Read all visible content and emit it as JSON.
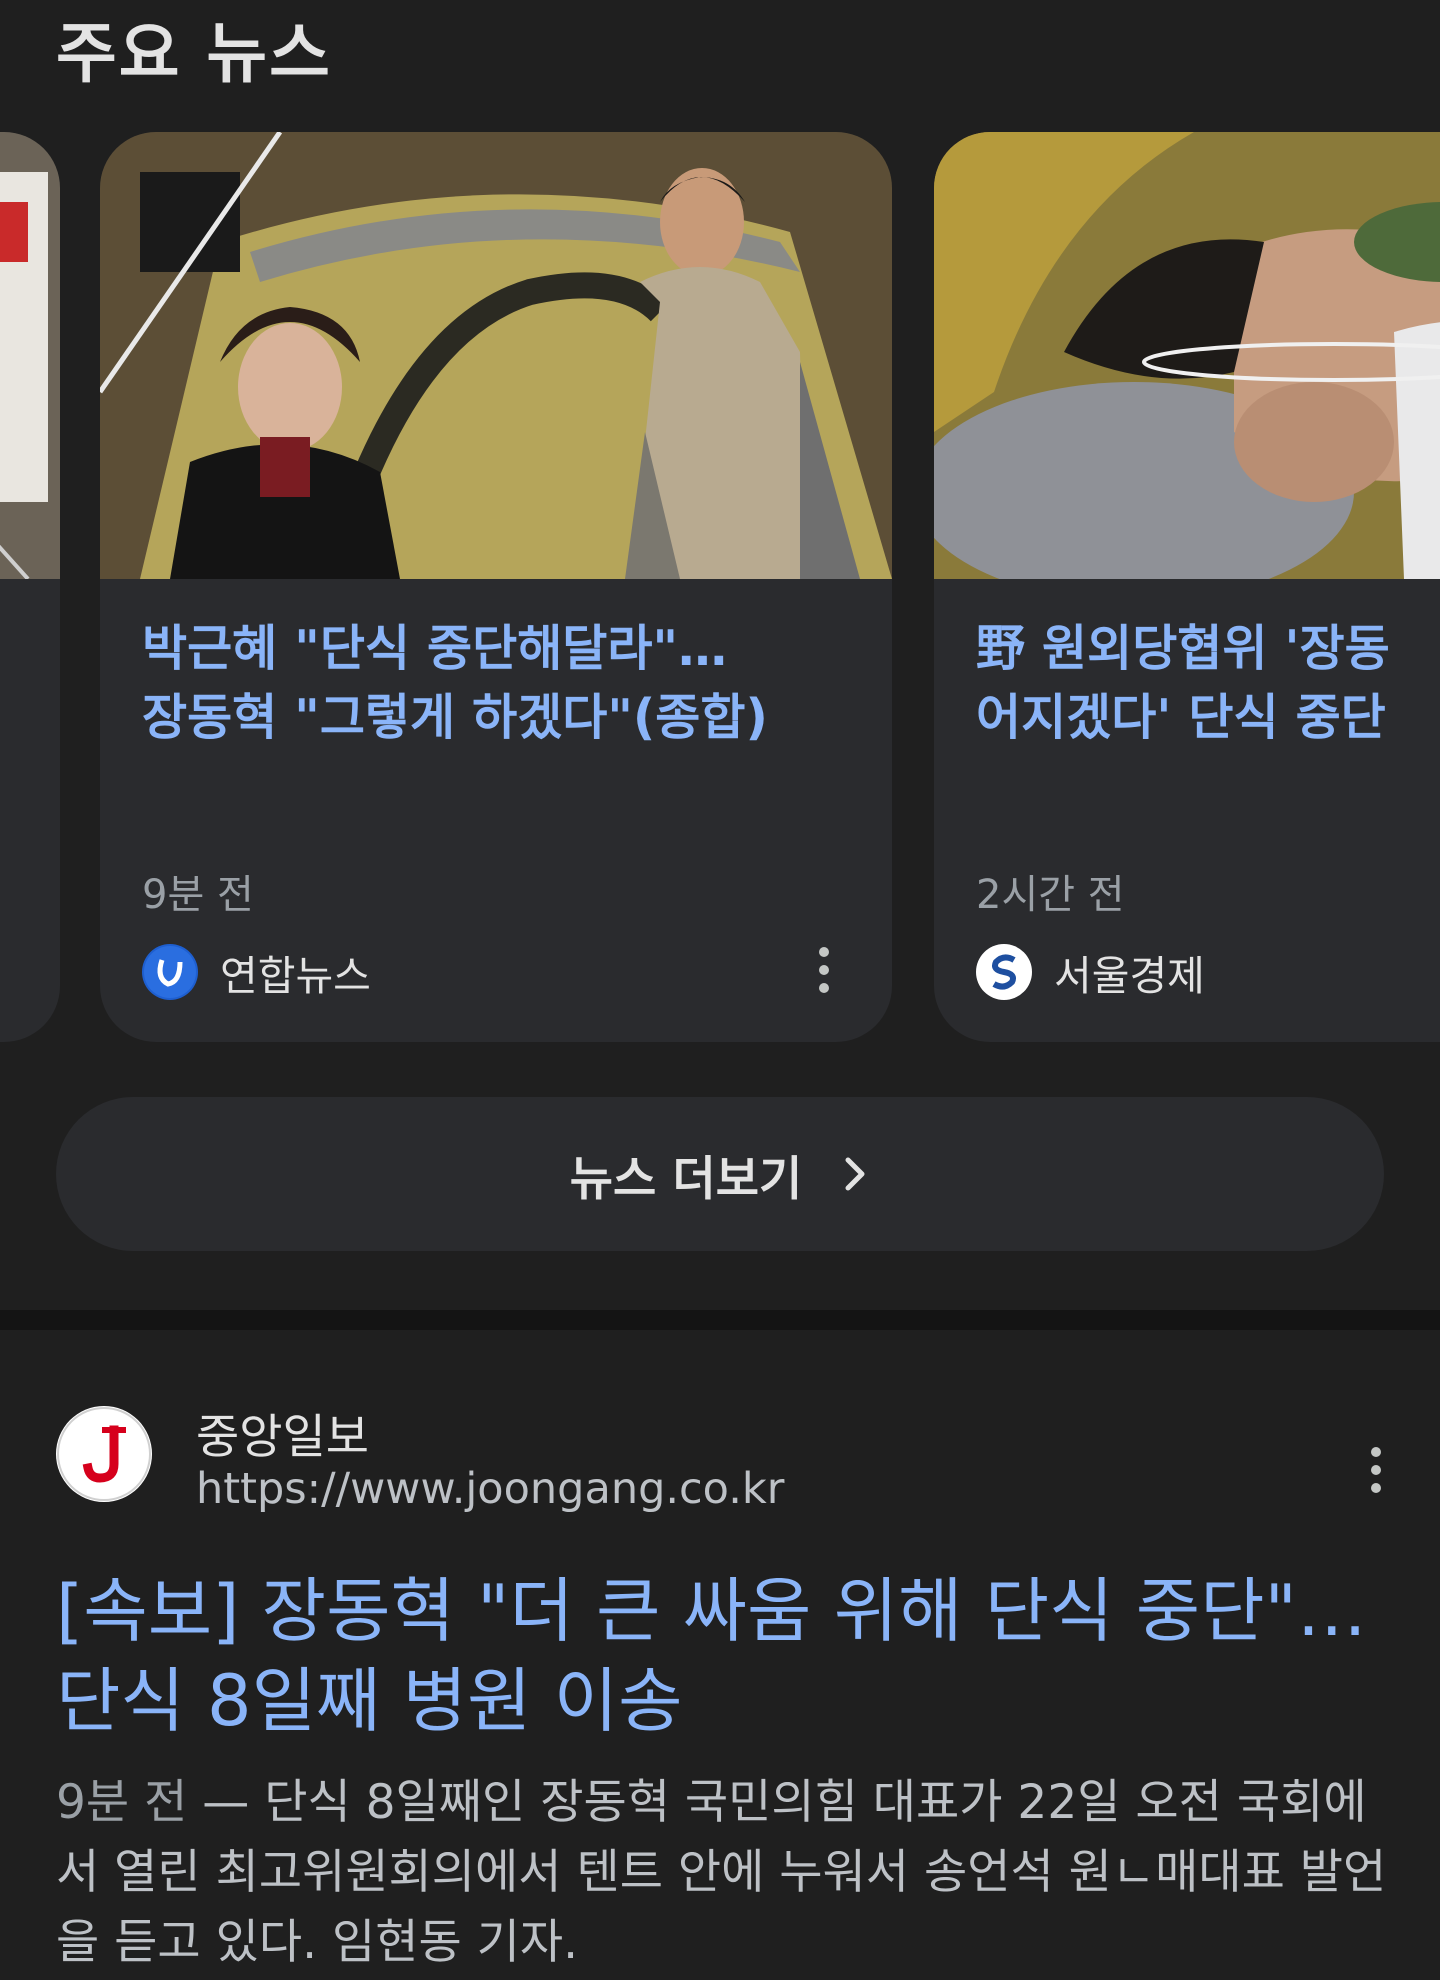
{
  "section": {
    "title": "주요 뉴스"
  },
  "cards": [
    {
      "title_lines": [
        "박근혜 \"단식 중단해달라\"…",
        "장동혁 \"그렇게 하겠다\"(종합)"
      ],
      "time": "9분 전",
      "source": "연합뉴스",
      "source_logo": "yonhap-logo"
    },
    {
      "title_lines": [
        "野 원외당협위 '장동",
        "어지겠다' 단식 중단"
      ],
      "time": "2시간 전",
      "source": "서울경제",
      "source_logo": "seoul-economic-logo"
    }
  ],
  "more_news": {
    "label": "뉴스 더보기",
    "icon": "chevron-right-icon"
  },
  "result": {
    "site_name": "중앙일보",
    "url": "https://www.joongang.co.kr",
    "logo_letter": "J",
    "title_lines": [
      "[속보] 장동혁 \"더 큰 싸움 위해 단식 중단\"…",
      "단식 8일째 병원 이송"
    ],
    "date": "9분 전",
    "separator": "—",
    "snippet": "단식 8일째인 장동혁 국민의힘 대표가 22일 오전 국회에서 열린 최고위원회의에서 텐트 안에 누워서 송언석 원ㄴ매대표 발언을 듣고 있다. 임현동 기자."
  },
  "colors": {
    "background": "#1f1f1f",
    "card": "#2a2b2e",
    "link": "#8ab4f8",
    "muted": "#9aa0a6",
    "joongang_red": "#d6001c"
  }
}
